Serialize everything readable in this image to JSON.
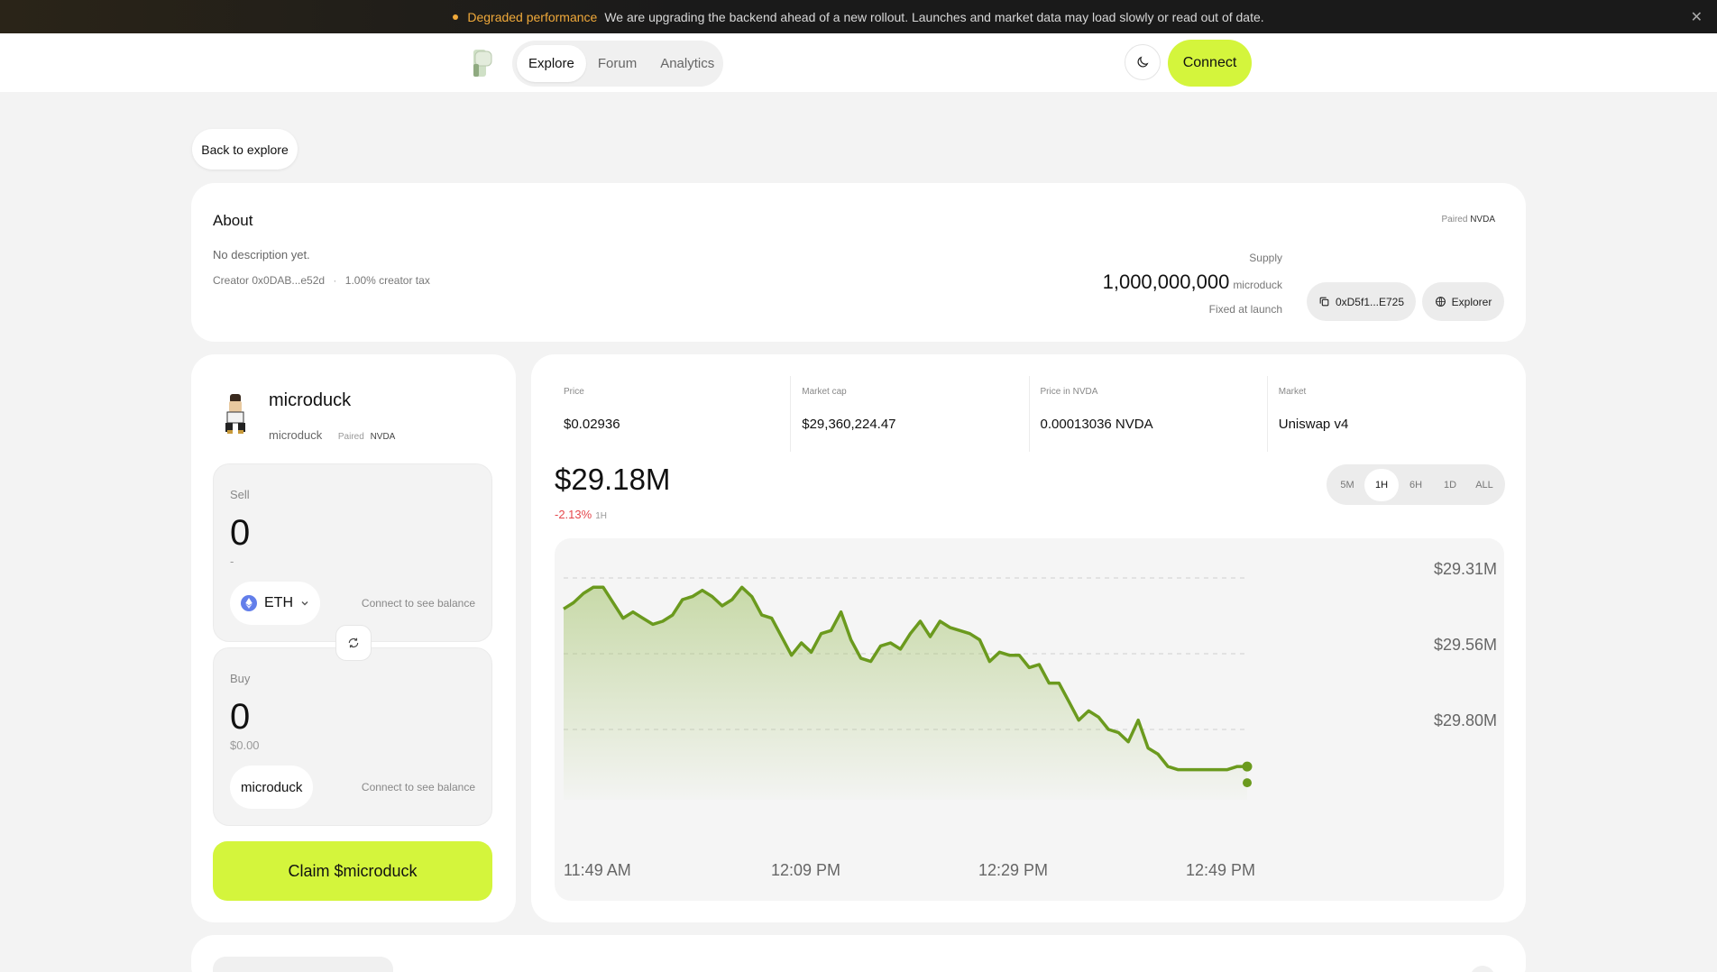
{
  "banner": {
    "status": "Degraded performance",
    "message": "We are upgrading the backend ahead of a new rollout. Launches and market data may load slowly or read out of date.",
    "accent": "#f0a93a"
  },
  "nav": {
    "items": [
      {
        "label": "Explore",
        "active": true
      },
      {
        "label": "Forum",
        "active": false
      },
      {
        "label": "Analytics",
        "active": false
      }
    ],
    "connect_label": "Connect",
    "accent": "#d4f53c"
  },
  "back_label": "Back to explore",
  "about": {
    "title": "About",
    "description": "No description yet.",
    "creator": "Creator 0x0DAB...e52d",
    "separator": "·",
    "tax": "1.00% creator tax",
    "paired_label": "Paired",
    "paired_value": "NVDA",
    "supply_label": "Supply",
    "supply_value": "1,000,000,000",
    "supply_unit": "microduck",
    "supply_note": "Fixed at launch",
    "address": "0xD5f1...E725",
    "explorer_label": "Explorer"
  },
  "swap": {
    "token_name": "microduck",
    "token_symbol": "microduck",
    "paired_label": "Paired",
    "paired_value": "NVDA",
    "sell": {
      "label": "Sell",
      "amount": "0",
      "usd": "-",
      "token": "ETH",
      "balance_hint": "Connect to see balance"
    },
    "buy": {
      "label": "Buy",
      "amount": "0",
      "usd": "$0.00",
      "token": "microduck",
      "balance_hint": "Connect to see balance"
    },
    "claim_label": "Claim $microduck"
  },
  "market": {
    "stats": [
      {
        "label": "Price",
        "value": "$0.02936"
      },
      {
        "label": "Market cap",
        "value": "$29,360,224.47"
      },
      {
        "label": "Price in NVDA",
        "value": "0.00013036 NVDA"
      },
      {
        "label": "Market",
        "value": "Uniswap v4"
      }
    ],
    "headline_value": "$29.18M",
    "change": "-2.13%",
    "change_period": "1H",
    "change_color": "#e5484d",
    "timeframes": [
      "5M",
      "1H",
      "6H",
      "1D",
      "ALL"
    ],
    "active_timeframe": "1H"
  },
  "chart_data": {
    "type": "area",
    "title": "",
    "xlabel": "",
    "ylabel": "",
    "y_tick_labels": [
      "$29.31M",
      "$29.56M",
      "$29.80M"
    ],
    "x_tick_labels": [
      "11:49 AM",
      "12:09 PM",
      "12:29 PM",
      "12:49 PM"
    ],
    "color": "#6b9a1e",
    "grid": true,
    "series": [
      {
        "values": [
          29.41,
          29.39,
          29.36,
          29.34,
          29.34,
          29.39,
          29.44,
          29.42,
          29.44,
          29.46,
          29.45,
          29.43,
          29.38,
          29.37,
          29.35,
          29.37,
          29.4,
          29.38,
          29.34,
          29.37,
          29.43,
          29.44,
          29.5,
          29.56,
          29.52,
          29.55,
          29.49,
          29.48,
          29.42,
          29.51,
          29.57,
          29.58,
          29.53,
          29.52,
          29.54,
          29.49,
          29.45,
          29.5,
          29.45,
          29.47,
          29.48,
          29.49,
          29.51,
          29.58,
          29.55,
          29.56,
          29.56,
          29.6,
          29.59,
          29.65,
          29.65,
          29.71,
          29.77,
          29.74,
          29.76,
          29.8,
          29.81,
          29.84,
          29.77,
          29.86,
          29.88,
          29.92,
          29.93,
          29.93,
          29.93,
          29.93,
          29.93,
          29.93,
          29.92,
          29.92
        ]
      }
    ]
  },
  "bottom_peek": ""
}
